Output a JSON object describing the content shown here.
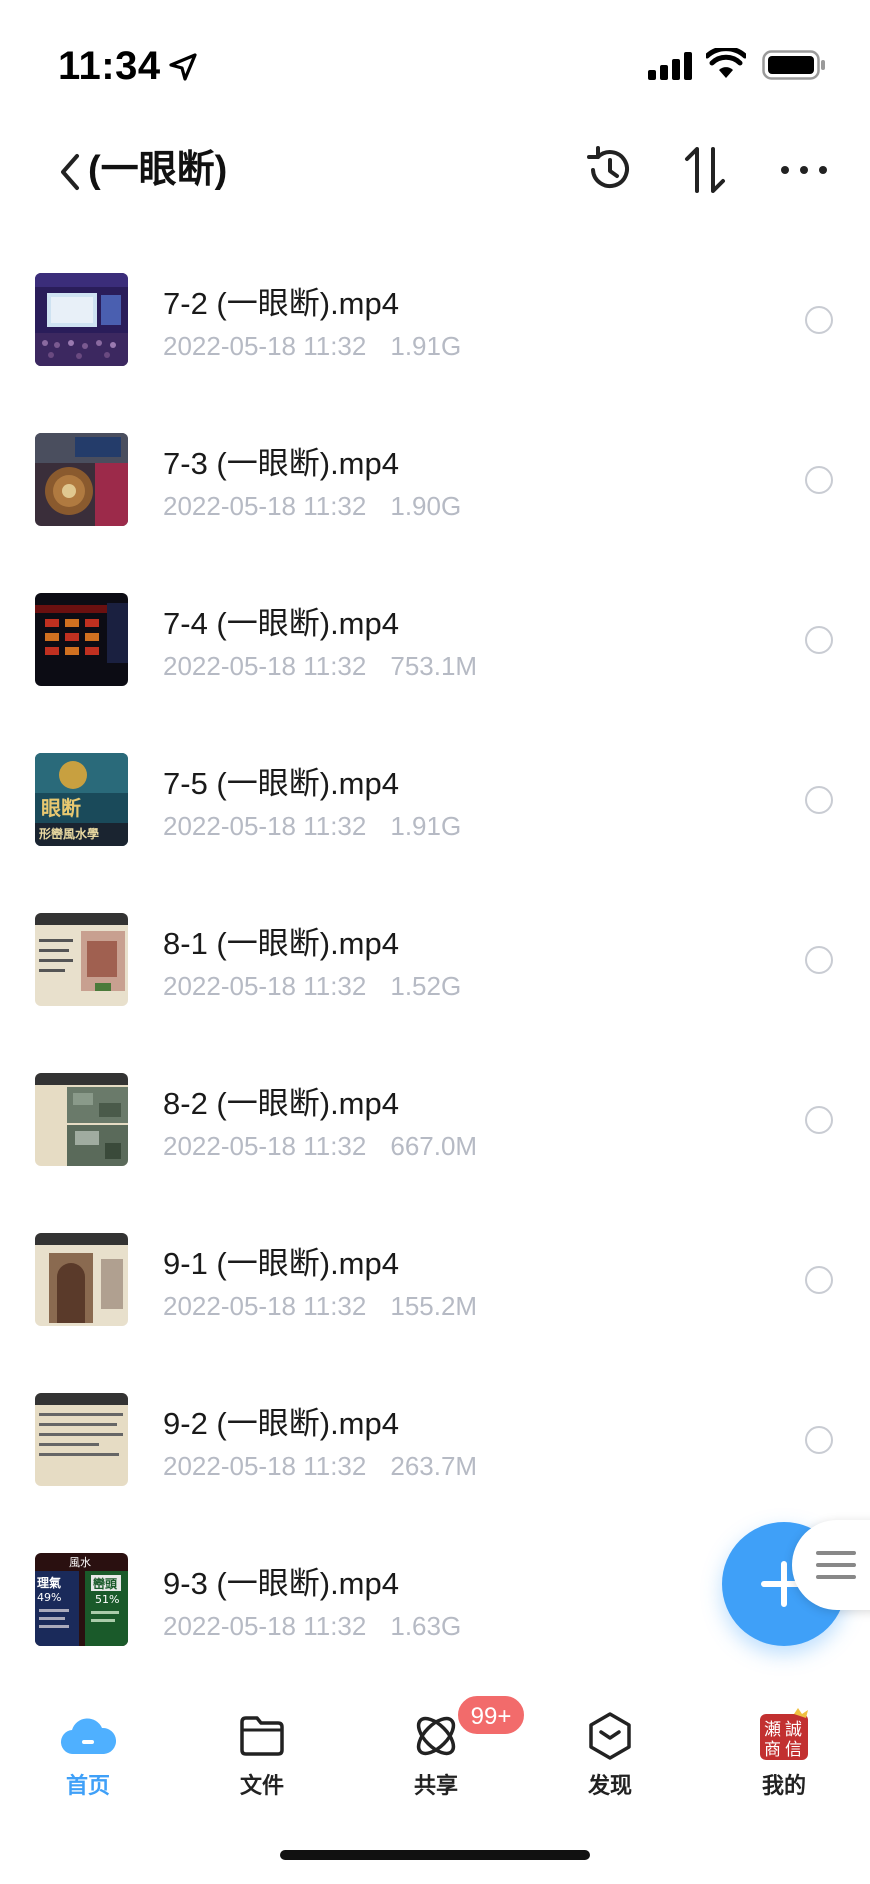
{
  "status_bar": {
    "time": "11:34"
  },
  "nav": {
    "title": "(一眼断)"
  },
  "files": [
    {
      "name": "7-2 (一眼断).mp4",
      "date": "2022-05-18 11:32",
      "size": "1.91G"
    },
    {
      "name": "7-3 (一眼断).mp4",
      "date": "2022-05-18 11:32",
      "size": "1.90G"
    },
    {
      "name": "7-4 (一眼断).mp4",
      "date": "2022-05-18 11:32",
      "size": "753.1M"
    },
    {
      "name": "7-5 (一眼断).mp4",
      "date": "2022-05-18 11:32",
      "size": "1.91G"
    },
    {
      "name": "8-1 (一眼断).mp4",
      "date": "2022-05-18 11:32",
      "size": "1.52G"
    },
    {
      "name": "8-2 (一眼断).mp4",
      "date": "2022-05-18 11:32",
      "size": "667.0M"
    },
    {
      "name": "9-1 (一眼断).mp4",
      "date": "2022-05-18 11:32",
      "size": "155.2M"
    },
    {
      "name": "9-2 (一眼断).mp4",
      "date": "2022-05-18 11:32",
      "size": "263.7M"
    },
    {
      "name": "9-3 (一眼断).mp4",
      "date": "2022-05-18 11:32",
      "size": "1.63G"
    }
  ],
  "thumbnails": {
    "t2": {
      "text": "眼断",
      "caption": "形巒風水學"
    },
    "t9": {
      "header": "風水",
      "left_pct": "49%",
      "right_pct": "51%",
      "left_label": "理氣",
      "right_label": "巒頭"
    }
  },
  "tabbar": {
    "tabs": [
      {
        "label": "首页",
        "icon": "cloud-icon",
        "active": true
      },
      {
        "label": "文件",
        "icon": "folder-icon"
      },
      {
        "label": "共享",
        "icon": "share-orbit-icon"
      },
      {
        "label": "发现",
        "icon": "discover-box-icon"
      },
      {
        "label": "我的",
        "icon": "avatar-seal-icon"
      }
    ],
    "share_badge": "99+"
  },
  "avatar_seal": {
    "chars": [
      "瀬",
      "誠",
      "商",
      "信"
    ]
  },
  "colors": {
    "accent": "#3fa0f8",
    "badge": "#f26b6b",
    "meta": "#b6bac4"
  }
}
